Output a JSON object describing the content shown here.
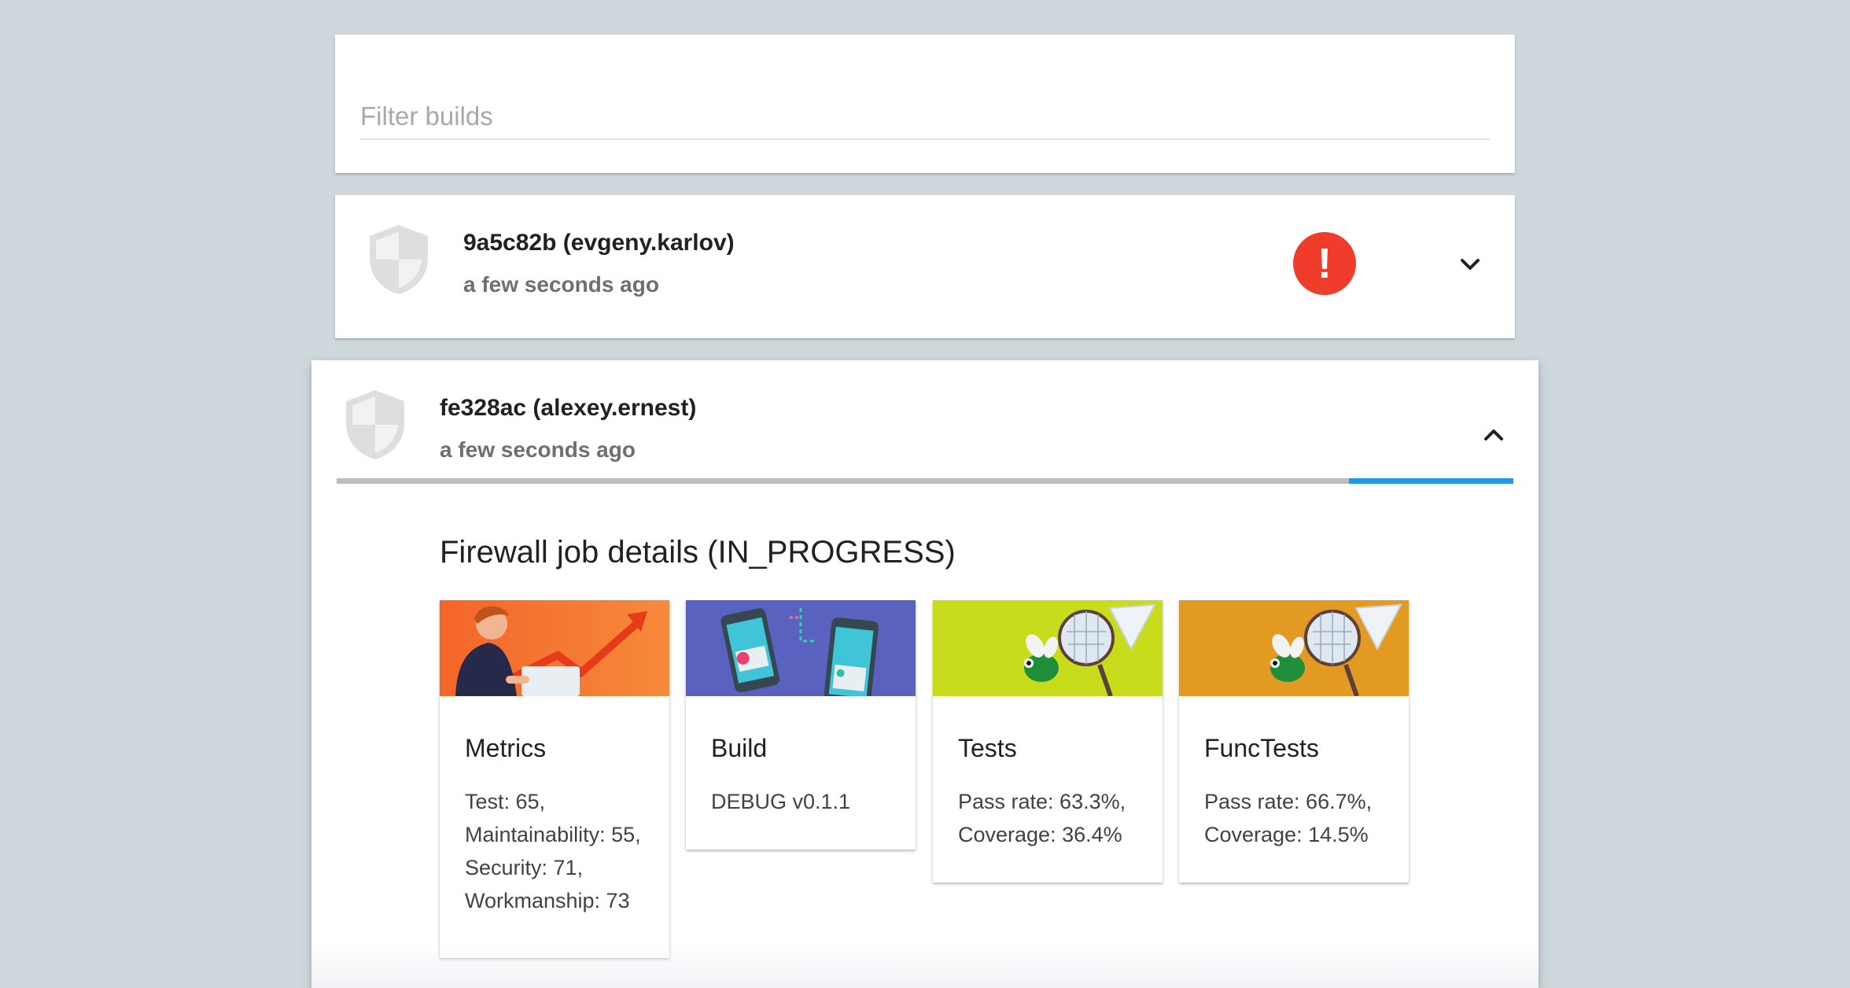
{
  "filter": {
    "placeholder": "Filter builds",
    "value": ""
  },
  "builds": [
    {
      "commit": "9a5c82b (evgeny.karlov)",
      "time": "a few seconds ago",
      "status_icon": "error-icon",
      "status_symbol": "!",
      "status_color": "#f03c2b",
      "expanded": false
    },
    {
      "commit": "fe328ac (alexey.ernest)",
      "time": "a few seconds ago",
      "expanded": true,
      "progress_percent": 14,
      "progress_color": "#1e9ae8",
      "details_title": "Firewall job details (IN_PROGRESS)",
      "tiles": [
        {
          "title": "Metrics",
          "image": "person-growth-chart-illustration",
          "lines": [
            "Test: 65,",
            "Maintainability: 55,",
            "Security: 71,",
            "Workmanship: 73"
          ]
        },
        {
          "title": "Build",
          "image": "phones-sync-illustration",
          "lines": [
            "DEBUG v0.1.1"
          ]
        },
        {
          "title": "Tests",
          "image": "bug-net-illustration",
          "lines": [
            "Pass rate: 63.3%,",
            "Coverage: 36.4%"
          ]
        },
        {
          "title": "FuncTests",
          "image": "bug-net-illustration",
          "lines": [
            "Pass rate: 66.7%,",
            "Coverage: 14.5%"
          ]
        }
      ]
    }
  ],
  "colors": {
    "background": "#cfd8dd",
    "error": "#f03c2b",
    "accent": "#1e9ae8"
  }
}
